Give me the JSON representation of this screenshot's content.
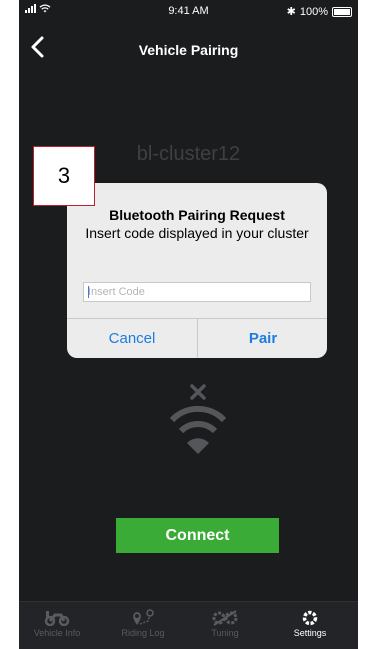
{
  "status": {
    "time": "9:41 AM",
    "battery": "100%"
  },
  "nav": {
    "title": "Vehicle Pairing"
  },
  "device_name": "bl-cluster12",
  "connect_label": "Connect",
  "dialog": {
    "title": "Bluetooth Pairing Request",
    "message": "Insert code displayed in your cluster",
    "placeholder": "Insert Code",
    "cancel": "Cancel",
    "pair": "Pair"
  },
  "tabs": [
    {
      "label": "Vehicle Info",
      "icon": "motorcycle-icon"
    },
    {
      "label": "Riding Log",
      "icon": "route-pin-icon"
    },
    {
      "label": "Tuning",
      "icon": "gears-icon"
    },
    {
      "label": "Settings",
      "icon": "gear-icon"
    }
  ],
  "annotation": "3",
  "colors": {
    "background": "#1b1c1e",
    "accent_green": "#3aab36",
    "link_blue": "#1f7ce0",
    "annotation_border": "#b8242b"
  }
}
